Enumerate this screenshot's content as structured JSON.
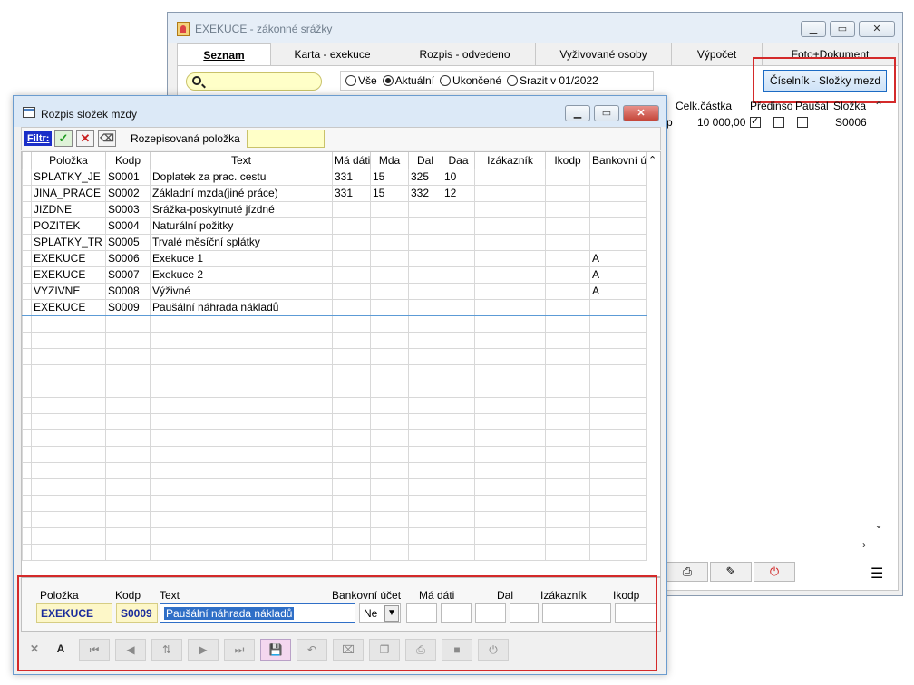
{
  "back_window": {
    "title": "EXEKUCE - zákonné srážky",
    "tabs": [
      "Seznam",
      "Karta - exekuce",
      "Rozpis - odvedeno",
      "Vyživované osoby",
      "Výpočet",
      "Foto+Dokument"
    ],
    "search_placeholder": "",
    "radios": [
      {
        "label": "Vše",
        "checked": false
      },
      {
        "label": "Aktuální",
        "checked": true
      },
      {
        "label": "Ukončené",
        "checked": false
      },
      {
        "label": "Srazit v 01/2022",
        "checked": false
      }
    ],
    "ciselnik_button": "Číselník - Složky mezd",
    "columns": {
      "celk": "Celk.částka",
      "predinso": "Předinso",
      "pausal": "Paušal",
      "slozka": "Složka"
    },
    "row": {
      "prefix": "p",
      "celk": "10 000,00",
      "predinso": true,
      "pausal": false,
      "extra": false,
      "slozka": "S0006"
    }
  },
  "front_window": {
    "title": "Rozpis složek mzdy",
    "filter_label": "Filtr:",
    "rozpisovana_label": "Rozepisovaná položka",
    "rozpisovana_value": "",
    "columns": [
      "Položka",
      "Kodp",
      "Text",
      "Má dáti",
      "Mda",
      "Dal",
      "Daa",
      "Izákazník",
      "Ikodp",
      "Bankovní ú"
    ],
    "rows": [
      [
        "SPLATKY_JE",
        "S0001",
        "Doplatek za prac. cestu",
        "331",
        "15",
        "325",
        "10",
        "",
        "",
        ""
      ],
      [
        "JINA_PRACE",
        "S0002",
        "Základní mzda(jiné práce)",
        "331",
        "15",
        "332",
        "12",
        "",
        "",
        ""
      ],
      [
        "JIZDNE",
        "S0003",
        "Srážka-poskytnuté jízdné",
        "",
        "",
        "",
        "",
        "",
        "",
        ""
      ],
      [
        "POZITEK",
        "S0004",
        "Naturální požitky",
        "",
        "",
        "",
        "",
        "",
        "",
        ""
      ],
      [
        "SPLATKY_TR",
        "S0005",
        "Trvalé měsíční splátky",
        "",
        "",
        "",
        "",
        "",
        "",
        ""
      ],
      [
        "EXEKUCE",
        "S0006",
        "Exekuce 1",
        "",
        "",
        "",
        "",
        "",
        "",
        "A"
      ],
      [
        "EXEKUCE",
        "S0007",
        "Exekuce 2",
        "",
        "",
        "",
        "",
        "",
        "",
        "A"
      ],
      [
        "VYZIVNE",
        "S0008",
        "Výživné",
        "",
        "",
        "",
        "",
        "",
        "",
        "A"
      ],
      [
        "EXEKUCE",
        "S0009",
        "Paušální náhrada nákladů",
        "",
        "",
        "",
        "",
        "",
        "",
        ""
      ]
    ],
    "edit": {
      "labels": {
        "polozka": "Položka",
        "kodp": "Kodp",
        "text": "Text",
        "bank": "Bankovní účet",
        "madati": "Má dáti",
        "dal": "Dal",
        "izak": "Izákazník",
        "ikodp": "Ikodp"
      },
      "values": {
        "polozka": "EXEKUCE",
        "kodp": "S0009",
        "text": "Paušální náhrada nákladů",
        "bank": "Ne",
        "madati": "",
        "mda": "",
        "dal": "",
        "daa": "",
        "izak": "",
        "ikodp": ""
      }
    }
  }
}
